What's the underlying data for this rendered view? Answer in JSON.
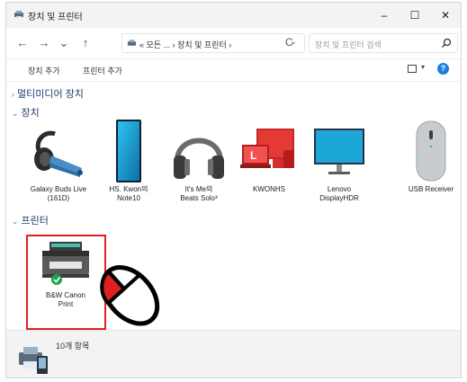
{
  "window": {
    "title": "장치 및 프린터",
    "controls": {
      "minimize": "–",
      "maximize": "☐",
      "close": "✕"
    }
  },
  "nav": {
    "back": "←",
    "forward": "→",
    "history": "⌄",
    "up": "↑",
    "breadcrumb": "« 모든 ... › 장치 및 프린터 ›",
    "refresh": "C",
    "search_placeholder": "장치 및 프린터 검색"
  },
  "toolbar": {
    "add_device": "장치 추가",
    "add_printer": "프린터 추가"
  },
  "sections": {
    "multimedia": "멀티미디어 장치",
    "devices": "장치",
    "printers": "프린터"
  },
  "devices": [
    {
      "label_line1": "Galaxy Buds Live",
      "label_line2": "(161D)",
      "icon": "headset-icon"
    },
    {
      "label_line1": "HS. Kwon의",
      "label_line2": "Note10",
      "icon": "phone-icon"
    },
    {
      "label_line1": "It's Me의",
      "label_line2": "Beats Solo³",
      "icon": "headphones-icon"
    },
    {
      "label_line1": "KWONHS",
      "label_line2": "",
      "icon": "computer-icon"
    },
    {
      "label_line1": "Lenovo",
      "label_line2": "DisplayHDR",
      "icon": "monitor-icon"
    },
    {
      "label_line1": "USB Receiver",
      "label_line2": "",
      "icon": "mouse-icon"
    }
  ],
  "printers": [
    {
      "label_line1": "B&W Canon",
      "label_line2": "Print",
      "icon": "printer-icon",
      "default": true
    }
  ],
  "status": {
    "item_count": "10개 항목"
  },
  "colors": {
    "accent": "#1a7fe0",
    "selection": "#e02020",
    "default_check": "#1fa34a"
  }
}
